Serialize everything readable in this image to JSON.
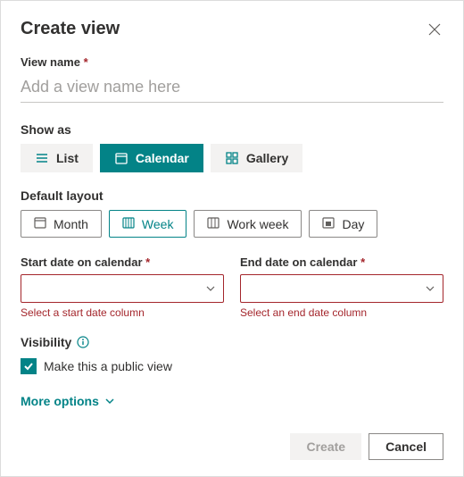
{
  "header": {
    "title": "Create view"
  },
  "viewName": {
    "label": "View name",
    "placeholder": "Add a view name here",
    "value": ""
  },
  "showAs": {
    "label": "Show as",
    "options": {
      "list": "List",
      "calendar": "Calendar",
      "gallery": "Gallery"
    },
    "selected": "calendar"
  },
  "layout": {
    "label": "Default layout",
    "options": {
      "month": "Month",
      "week": "Week",
      "workweek": "Work week",
      "day": "Day"
    },
    "selected": "week"
  },
  "dates": {
    "start": {
      "label": "Start date on calendar",
      "value": "",
      "error": "Select a start date column"
    },
    "end": {
      "label": "End date on calendar",
      "value": "",
      "error": "Select an end date column"
    }
  },
  "visibility": {
    "label": "Visibility",
    "checkLabel": "Make this a public view",
    "checked": true
  },
  "moreOptions": "More options",
  "footer": {
    "create": "Create",
    "createEnabled": false,
    "cancel": "Cancel"
  }
}
